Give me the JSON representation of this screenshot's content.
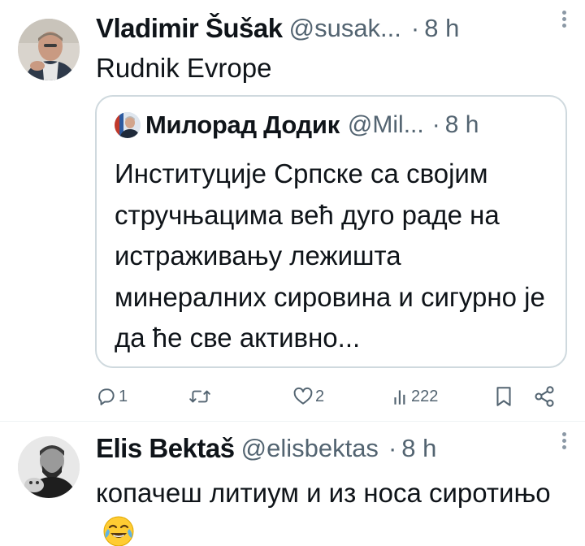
{
  "tweets": [
    {
      "author_name": "Vladimir Šušak",
      "handle": "@susak...",
      "dot": "·",
      "time": "8 h",
      "text": "Rudnik Evrope",
      "quote": {
        "author_name": "Милорад Додик",
        "handle": "@Mil...",
        "dot": "·",
        "time": "8 h",
        "text": "Институције Српске са својим стручњацима већ дуго раде на истраживању лежишта минералних сировина и сигурно је да ће све активно..."
      },
      "actions": {
        "reply_count": "1",
        "retweet_count": "",
        "like_count": "2",
        "view_count": "222"
      }
    },
    {
      "author_name": "Elis Bektaš",
      "handle": "@elisbektas",
      "dot": "·",
      "time": "8 h",
      "text": "копачеш литиум и из носа сиротињо",
      "emoji": "face-with-tears-of-joy"
    }
  ],
  "colors": {
    "text_primary": "#0f1419",
    "text_secondary": "#536471",
    "border": "#cfd9de",
    "divider": "#eff3f4",
    "background": "#ffffff"
  }
}
